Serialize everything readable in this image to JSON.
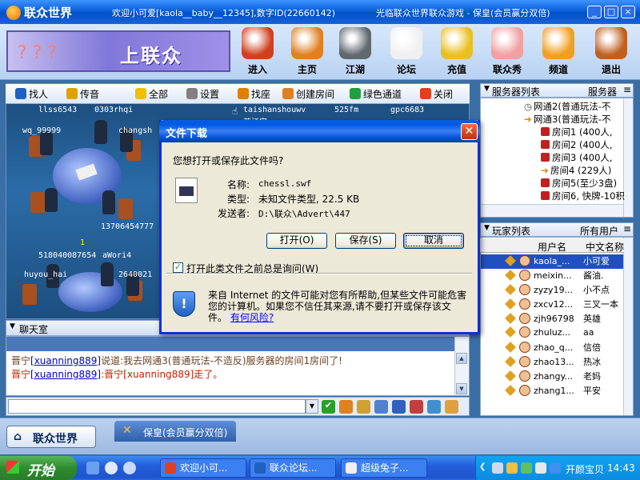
{
  "app": {
    "logo": "联众世界",
    "welcome": "欢迎小可爱[kaola__baby__12345],数字ID(22660142)",
    "title_right": "光临联众世界联众游戏 - 保皇(会员赢分双倍)",
    "banner": "上联众"
  },
  "toolbar": [
    {
      "label": "进入",
      "icon": "joystick-icon",
      "color": "#d04020"
    },
    {
      "label": "主页",
      "icon": "house-icon",
      "color": "#e08020"
    },
    {
      "label": "江湖",
      "icon": "swords-icon",
      "color": "#606870"
    },
    {
      "label": "论坛",
      "icon": "bbs-cup-icon",
      "color": "#f0f0f0"
    },
    {
      "label": "充值",
      "icon": "coins-icon",
      "color": "#e8c020"
    },
    {
      "label": "联众秀",
      "icon": "doll-icon",
      "color": "#f0a0a0"
    },
    {
      "label": "频道",
      "icon": "tv-icon",
      "color": "#f0a020"
    },
    {
      "label": "退出",
      "icon": "door-icon",
      "color": "#c06020"
    }
  ],
  "left_tabs": [
    {
      "label": "找人",
      "icon": "find-person-icon",
      "color": "#2060c0"
    },
    {
      "label": "传音",
      "icon": "megaphone-icon",
      "color": "#e0a000"
    },
    {
      "label": "全部",
      "icon": "star-icon",
      "color": "#f0c000"
    },
    {
      "label": "设置",
      "icon": "wrench-icon",
      "color": "#808080"
    },
    {
      "label": "找座",
      "icon": "pencil-icon",
      "color": "#e08000"
    },
    {
      "label": "创建房间",
      "icon": "house-add-icon",
      "color": "#e08020"
    },
    {
      "label": "绿色通道",
      "icon": "green-channel-icon",
      "color": "#20a040"
    },
    {
      "label": "关闭",
      "icon": "close-circle-icon",
      "color": "#e04020"
    }
  ],
  "game_players": {
    "t1": [
      "llss6543",
      "0303rhqi",
      "wq_99999",
      "changsh",
      "13706454777"
    ],
    "t2": [
      "1",
      "518040087654",
      "aWori4",
      "huyou_hai",
      "2640021"
    ],
    "top_right": [
      "taishanshouwv",
      "525fm",
      "gpc6683",
      "蓝江家"
    ]
  },
  "chat": {
    "title": "聊天室",
    "lines": [
      {
        "name": "晋宁",
        "id": "[xuanning889]",
        "text": "说道:我去网通3(普通玩法-不造反)服务器的房间1房间了!"
      },
      {
        "name": "晋宁",
        "id": "[xuanning889]",
        "text": ":晋宁[xuanning889]走了。"
      }
    ]
  },
  "servers": {
    "title": "服务器列表",
    "menu": "服务器",
    "items": [
      {
        "text": "网通2(普通玩法-不",
        "indent": 55,
        "kind": "server"
      },
      {
        "text": "网通3(普通玩法-不",
        "indent": 55,
        "kind": "server-open"
      },
      {
        "text": "房间1 (400人,",
        "indent": 76,
        "kind": "room"
      },
      {
        "text": "房间2 (400人,",
        "indent": 76,
        "kind": "room"
      },
      {
        "text": "房间3 (400人,",
        "indent": 76,
        "kind": "room"
      },
      {
        "text": "房间4 (229人)",
        "indent": 76,
        "kind": "current"
      },
      {
        "text": "房间5(至少3盘)",
        "indent": 76,
        "kind": "room"
      },
      {
        "text": "房间6, 快牌-10积",
        "indent": 76,
        "kind": "room"
      }
    ]
  },
  "players": {
    "title": "玩家列表",
    "menu": "所有用户",
    "col_user": "用户名",
    "col_cn": "中文名称",
    "rows": [
      {
        "user": "kaola_...",
        "cn": "小可爱",
        "selected": true
      },
      {
        "user": "meixin...",
        "cn": "酱油.",
        "selected": false
      },
      {
        "user": "zyzy19...",
        "cn": "小不点",
        "selected": false
      },
      {
        "user": "zxcv12...",
        "cn": "三叉一本",
        "selected": false
      },
      {
        "user": "zjh96798",
        "cn": "英雄",
        "selected": false
      },
      {
        "user": "zhuluz...",
        "cn": "aa",
        "selected": false
      },
      {
        "user": "zhao_q...",
        "cn": "信倍",
        "selected": false
      },
      {
        "user": "zhao13...",
        "cn": "热冰",
        "selected": false
      },
      {
        "user": "zhangy...",
        "cn": "老妈",
        "selected": false
      },
      {
        "user": "zhang1...",
        "cn": "平安",
        "selected": false
      }
    ]
  },
  "bottom": {
    "home": "联众世界",
    "room_tab": "保皇(会员赢分双倍)"
  },
  "dialog": {
    "title": "文件下载",
    "question": "您想打开或保存此文件吗?",
    "name_label": "名称:",
    "name_value": "chessl.swf",
    "type_label": "类型:",
    "type_value": "未知文件类型, 22.5 KB",
    "from_label": "发送者:",
    "from_value": "D:\\联众\\Advert\\447",
    "open": "打开(O)",
    "save": "保存(S)",
    "cancel": "取消",
    "checkbox": "打开此类文件之前总是询问(W)",
    "warning": "来自 Internet 的文件可能对您有所帮助,但某些文件可能危害您的计算机。如果您不信任其来源,请不要打开或保存该文件。",
    "risk_link": "有何风险?"
  },
  "taskbar": {
    "start": "开始",
    "items": [
      "欢迎小可...",
      "联众论坛...",
      "超级兔子..."
    ],
    "tray_text": "开颜宝贝",
    "clock": "14:43"
  }
}
